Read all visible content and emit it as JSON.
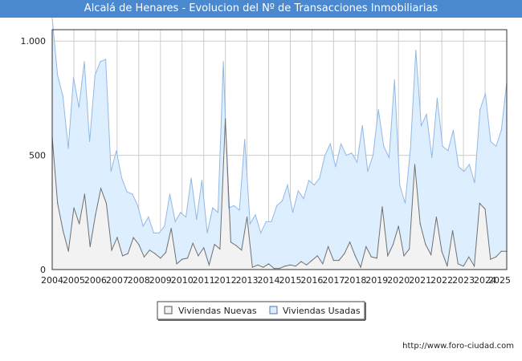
{
  "header": {
    "title": "Alcalá de Henares - Evolucion del Nº de Transacciones Inmobiliarias"
  },
  "footer": {
    "credit": "http://www.foro-ciudad.com"
  },
  "colors": {
    "title_bg": "#4a88d0",
    "usadas_line": "#93b8e6",
    "usadas_fill": "#ddeeff",
    "nuevas_line": "#707070",
    "nuevas_fill": "#f2f2f2",
    "grid": "#cccccc"
  },
  "chart_data": {
    "type": "area",
    "title": "Alcalá de Henares - Evolucion del Nº de Transacciones Inmobiliarias",
    "xlabel": "",
    "ylabel": "",
    "x_tick_labels": [
      "2004",
      "2005",
      "2006",
      "2007",
      "2008",
      "2009",
      "2010",
      "2011",
      "2012",
      "2013",
      "2014",
      "2015",
      "2016",
      "2017",
      "2018",
      "2019",
      "2020",
      "2021",
      "2022",
      "2023",
      "2024",
      "2025"
    ],
    "y_ticks": [
      0,
      500,
      1000
    ],
    "y_tick_labels": [
      "0",
      "500",
      "1.000"
    ],
    "ylim": [
      0,
      1050
    ],
    "grid": true,
    "legend_position": "bottom",
    "series": [
      {
        "name": "Viviendas Nuevas",
        "values": [
          580,
          290,
          170,
          80,
          270,
          200,
          330,
          100,
          240,
          355,
          290,
          85,
          140,
          60,
          70,
          140,
          110,
          55,
          85,
          70,
          50,
          75,
          180,
          25,
          45,
          50,
          115,
          60,
          95,
          20,
          110,
          90,
          660,
          120,
          105,
          85,
          230,
          10,
          20,
          10,
          25,
          5,
          5,
          15,
          20,
          15,
          35,
          20,
          40,
          60,
          25,
          100,
          40,
          40,
          70,
          120,
          60,
          10,
          100,
          55,
          50,
          275,
          60,
          110,
          190,
          60,
          90,
          460,
          200,
          110,
          65,
          230,
          80,
          15,
          170,
          25,
          15,
          55,
          15,
          290,
          265,
          45,
          55,
          80,
          80
        ],
        "color": "#707070"
      },
      {
        "name": "Viviendas Usadas",
        "values": [
          1100,
          850,
          760,
          530,
          840,
          710,
          910,
          560,
          850,
          910,
          920,
          430,
          520,
          400,
          340,
          330,
          280,
          190,
          230,
          160,
          160,
          190,
          330,
          210,
          250,
          230,
          400,
          220,
          390,
          160,
          270,
          250,
          910,
          270,
          280,
          260,
          570,
          200,
          240,
          160,
          210,
          210,
          280,
          300,
          370,
          250,
          345,
          310,
          390,
          370,
          400,
          500,
          550,
          450,
          550,
          500,
          510,
          470,
          630,
          430,
          500,
          700,
          540,
          490,
          830,
          370,
          290,
          530,
          960,
          630,
          680,
          490,
          750,
          540,
          520,
          610,
          450,
          430,
          460,
          380,
          700,
          770,
          560,
          540,
          610,
          820
        ]
      }
    ]
  }
}
